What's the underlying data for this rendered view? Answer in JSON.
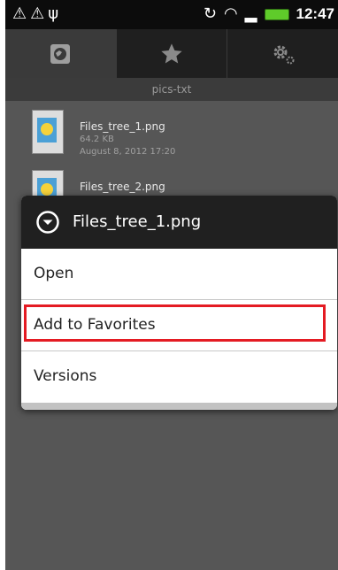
{
  "status_bar": {
    "time": "12:47"
  },
  "tabs": [
    {
      "name": "browse",
      "icon": "globe-icon",
      "active": true
    },
    {
      "name": "favorites",
      "icon": "star-icon",
      "active": false
    },
    {
      "name": "settings",
      "icon": "gear-icon",
      "active": false
    }
  ],
  "path": "pics-txt",
  "files": [
    {
      "name": "Files_tree_1.png",
      "size": "64.2 KB",
      "date": "August 8, 2012 17:20"
    },
    {
      "name": "Files_tree_2.png",
      "size": "",
      "date": ""
    }
  ],
  "dialog": {
    "title": "Files_tree_1.png",
    "items": [
      {
        "label": "Open"
      },
      {
        "label": "Add to Favorites"
      },
      {
        "label": "Versions"
      }
    ],
    "highlight_color": "#e41b23"
  }
}
